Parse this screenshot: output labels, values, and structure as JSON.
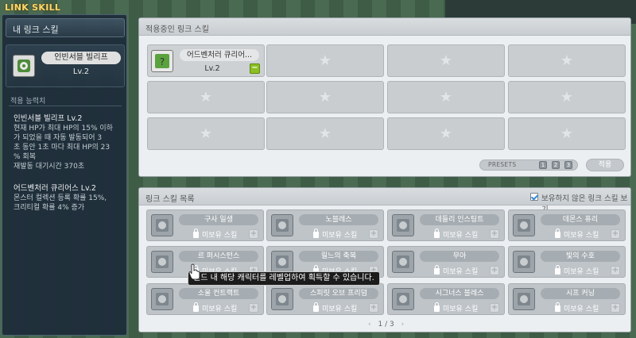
{
  "window_title": "LINK SKILL",
  "left": {
    "header": "내 링크 스킬",
    "my_skill": {
      "name": "인빈서블 빌리프",
      "level": "Lv.2",
      "icon": "invincible-belief-icon"
    },
    "effect_title": "적용 능력치",
    "effects": [
      {
        "title": "인빈서블 빌리프 Lv.2",
        "lines": [
          "현재 HP가 최대 HP의 15% 이하",
          "가 되었을 때 자동 발동되어 3",
          "초 동안 1초 마다 최대 HP의 23",
          "% 회복",
          "재발동 대기시간 370초"
        ]
      },
      {
        "title": "어드벤처러 큐리어스 Lv.2",
        "lines": [
          "몬스터 컬렉션 등록 확률 15%,",
          "크리티컬 확률 4% 증가"
        ]
      }
    ]
  },
  "applied": {
    "header": "적용중인 링크 스킬",
    "filled_slot": {
      "name": "어드벤처러 큐리어...",
      "level": "Lv.2",
      "remove": "−",
      "icon": "adventurer-curious-icon"
    },
    "empty_icon": "★",
    "presets_label": "PRESETS",
    "presets": [
      "1",
      "2",
      "3"
    ],
    "apply_label": "적용"
  },
  "list": {
    "header": "링크 스킬 목록",
    "show_unowned": "보유하지 않은 링크 스킬 보기",
    "locked_label": "미보유 스킬",
    "plus": "+",
    "skills": [
      {
        "name": "구사 일생",
        "icon": "cygnus-spirit-icon"
      },
      {
        "name": "노블레스",
        "icon": "noblesse-icon"
      },
      {
        "name": "데들리 인스팅트",
        "icon": "deadly-instinct-icon"
      },
      {
        "name": "데몬스 퓨리",
        "icon": "demons-fury-icon"
      },
      {
        "name": "르 퍼시스턴스",
        "icon": "persistence-icon"
      },
      {
        "name": "릴느의 축복",
        "icon": "blessing-icon"
      },
      {
        "name": "무아",
        "icon": "mua-icon"
      },
      {
        "name": "빛의 수호",
        "icon": "light-guard-icon"
      },
      {
        "name": "소울 컨트랙트",
        "icon": "soul-contract-icon"
      },
      {
        "name": "스피릿 오브 프리덤",
        "icon": "spirit-of-freedom-icon"
      },
      {
        "name": "시그너스 블레스",
        "icon": "cygnus-bless-icon"
      },
      {
        "name": "시프 커닝",
        "icon": "thief-cunning-icon"
      }
    ],
    "pager": {
      "prev": "‹",
      "current": "1",
      "sep": "/",
      "total": "3",
      "next": "›"
    }
  },
  "tooltip": "월드 내 해당 캐릭터를 레벨업하여 획득할 수 있습니다.",
  "colors": {
    "title": "#ffd76a",
    "accent_green": "#8cbf23",
    "check_blue": "#3a8ad6"
  }
}
